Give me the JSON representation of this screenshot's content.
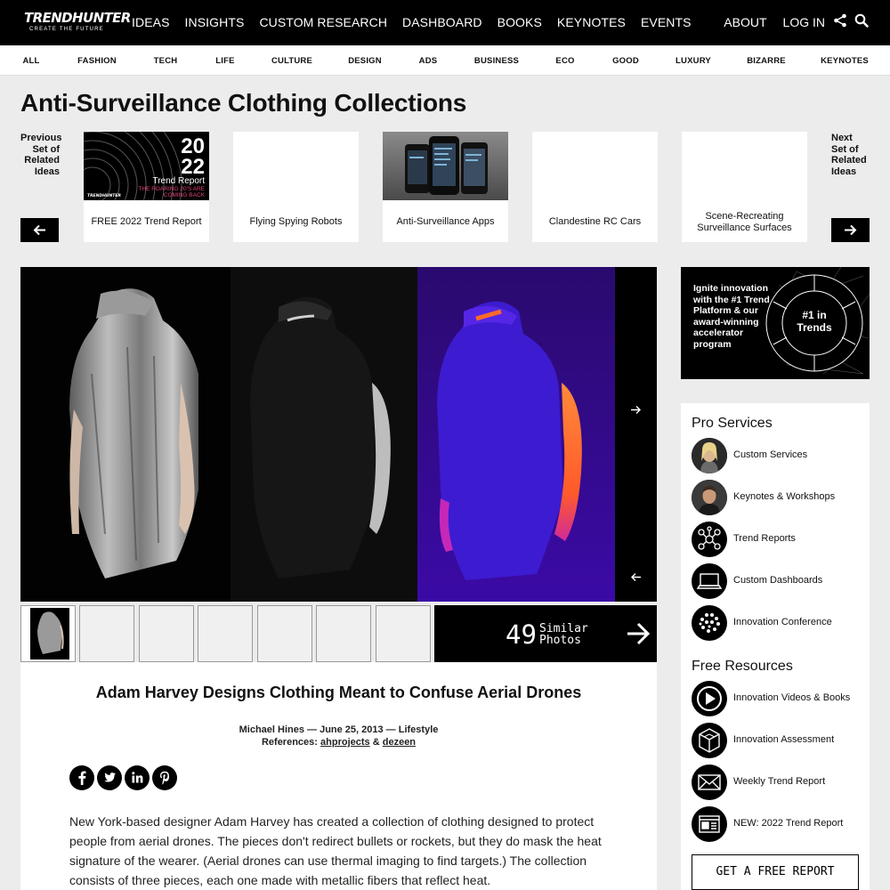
{
  "logo": {
    "main": "TRENDHUNTER",
    "tagline": "CREATE THE FUTURE"
  },
  "nav": {
    "items": [
      "IDEAS",
      "INSIGHTS",
      "CUSTOM RESEARCH",
      "DASHBOARD",
      "BOOKS",
      "KEYNOTES",
      "EVENTS"
    ],
    "right": [
      "ABOUT",
      "LOG IN"
    ]
  },
  "categories": [
    "ALL",
    "FASHION",
    "TECH",
    "LIFE",
    "CULTURE",
    "DESIGN",
    "ADS",
    "BUSINESS",
    "ECO",
    "GOOD",
    "LUXURY",
    "BIZARRE",
    "KEYNOTES"
  ],
  "page_title": "Anti-Surveillance Clothing Collections",
  "related": {
    "prev_label": "Previous Set of Related Ideas",
    "next_label": "Next Set of Related Ideas",
    "cards": [
      {
        "caption": "FREE 2022 Trend Report",
        "thumb": {
          "year_top": "20",
          "year_bottom": "22",
          "title": "Trend Report",
          "tagline_1": "THE ROARING 20'S ARE",
          "tagline_2": "COMING BACK",
          "brand": "TRENDHUNTER"
        }
      },
      {
        "caption": "Flying Spying Robots"
      },
      {
        "caption": "Anti-Surveillance Apps"
      },
      {
        "caption": "Clandestine RC Cars"
      },
      {
        "caption": "Scene-Recreating Surveillance Surfaces"
      }
    ]
  },
  "gallery": {
    "similar_count": "49",
    "similar_label_1": "Similar",
    "similar_label_2": "Photos"
  },
  "article": {
    "title": "Adam Harvey Designs Clothing Meant to Confuse Aerial Drones",
    "byline": "Michael Hines — June 25, 2013 — Lifestyle",
    "refs_label": "References:",
    "ref_1": "ahprojects",
    "ref_sep": "&",
    "ref_2": "dezeen",
    "body": "New York-based designer Adam Harvey has created a collection of clothing designed to protect people from aerial drones. The pieces don't redirect bullets or rockets, but they do mask the heat signature of the wearer. (Aerial drones can use thermal imaging to find targets.) The collection consists of three pieces, each one made with metallic fibers that reflect heat."
  },
  "promo": {
    "text": "Ignite innovation with the #1 Trend Platform & our award-winning accelerator program",
    "badge_line_1": "#1 in",
    "badge_line_2": "Trends"
  },
  "sidebar": {
    "pro_heading": "Pro Services",
    "pro_items": [
      "Custom Services",
      "Keynotes & Workshops",
      "Trend Reports",
      "Custom Dashboards",
      "Innovation Conference"
    ],
    "free_heading": "Free Resources",
    "free_items": [
      "Innovation Videos & Books",
      "Innovation Assessment",
      "Weekly Trend Report",
      "NEW: 2022 Trend Report"
    ],
    "cta": "GET A FREE REPORT"
  }
}
